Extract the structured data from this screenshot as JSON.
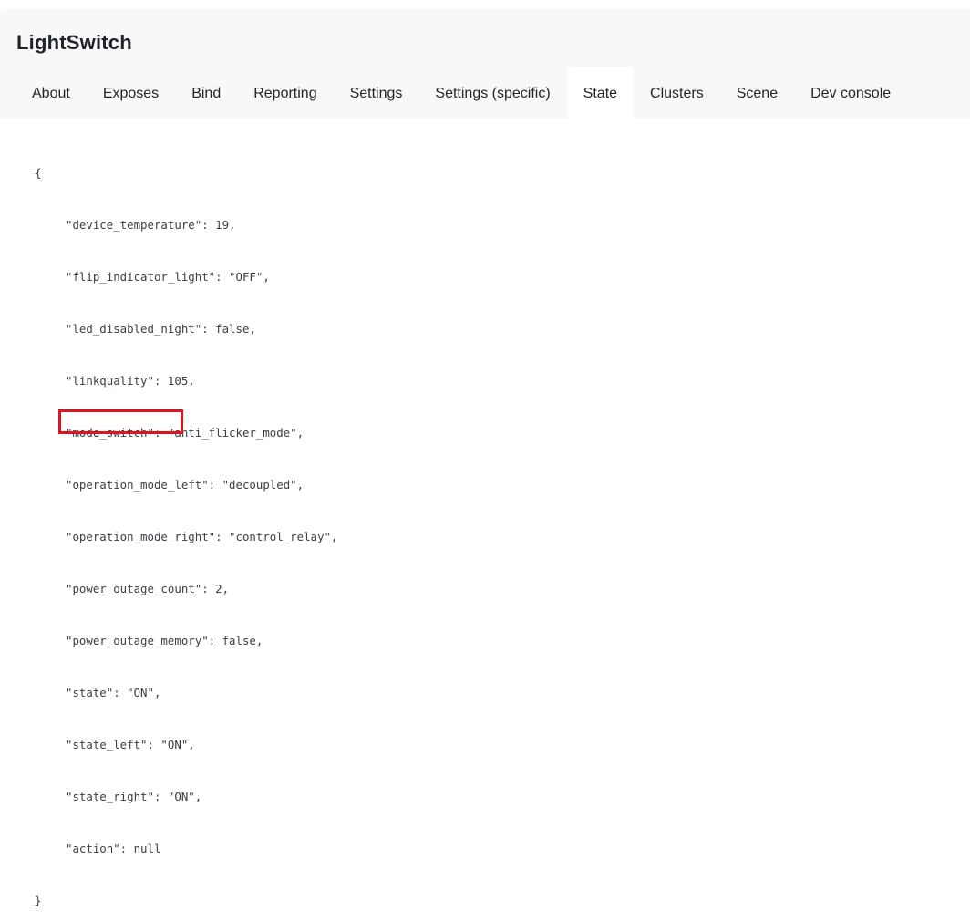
{
  "header": {
    "title": "LightSwitch",
    "tabs": [
      {
        "label": "About",
        "active": false
      },
      {
        "label": "Exposes",
        "active": false
      },
      {
        "label": "Bind",
        "active": false
      },
      {
        "label": "Reporting",
        "active": false
      },
      {
        "label": "Settings",
        "active": false
      },
      {
        "label": "Settings (specific)",
        "active": false
      },
      {
        "label": "State",
        "active": true
      },
      {
        "label": "Clusters",
        "active": false
      },
      {
        "label": "Scene",
        "active": false
      },
      {
        "label": "Dev console",
        "active": false
      }
    ]
  },
  "state_json": {
    "open_brace": "{",
    "close_brace": "}",
    "lines": [
      "\"device_temperature\": 19,",
      "\"flip_indicator_light\": \"OFF\",",
      "\"led_disabled_night\": false,",
      "\"linkquality\": 105,",
      "\"mode_switch\": \"anti_flicker_mode\",",
      "\"operation_mode_left\": \"decoupled\",",
      "\"operation_mode_right\": \"control_relay\",",
      "\"power_outage_count\": 2,",
      "\"power_outage_memory\": false,",
      "\"state\": \"ON\",",
      "\"state_left\": \"ON\",",
      "\"state_right\": \"ON\",",
      "\"action\": null"
    ],
    "highlighted_line": "\"action\": null"
  },
  "colors": {
    "header_bg": "#f8f8f9",
    "highlight_border": "#e0141e",
    "code_text": "#3a3f44"
  }
}
